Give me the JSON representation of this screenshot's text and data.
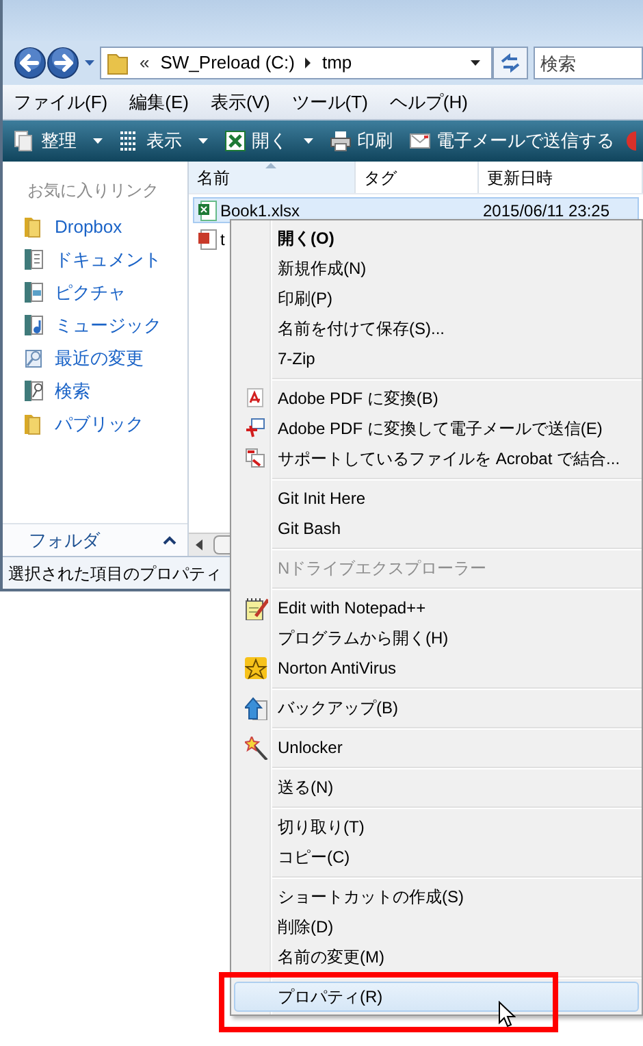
{
  "address": {
    "overflow": "«",
    "segments": [
      "SW_Preload (C:)",
      "tmp"
    ]
  },
  "search": {
    "placeholder": "検索"
  },
  "menu_bar": [
    "ファイル(F)",
    "編集(E)",
    "表示(V)",
    "ツール(T)",
    "ヘルプ(H)"
  ],
  "toolbar": [
    {
      "label": "整理",
      "kind": "organize",
      "dropdown": true
    },
    {
      "label": "表示",
      "kind": "views",
      "dropdown": true
    },
    {
      "label": "開く",
      "kind": "excel",
      "dropdown": true
    },
    {
      "label": "印刷",
      "kind": "print",
      "dropdown": false
    },
    {
      "label": "電子メールで送信する",
      "kind": "mail",
      "dropdown": false
    }
  ],
  "sidebar": {
    "header": "お気に入りリンク",
    "items": [
      {
        "label": "Dropbox",
        "kind": "folder"
      },
      {
        "label": "ドキュメント",
        "kind": "documents"
      },
      {
        "label": "ピクチャ",
        "kind": "pictures"
      },
      {
        "label": "ミュージック",
        "kind": "music"
      },
      {
        "label": "最近の変更",
        "kind": "recent"
      },
      {
        "label": "検索",
        "kind": "search"
      },
      {
        "label": "パブリック",
        "kind": "folder"
      }
    ],
    "folders": "フォルダ"
  },
  "table": {
    "columns": [
      "名前",
      "タグ",
      "更新日時"
    ],
    "rows": [
      {
        "name": "Book1.xlsx",
        "date": "2015/06/11 23:25",
        "kind": "excel",
        "selected": true
      },
      {
        "name": "t",
        "kind": "pdf",
        "selected": false
      }
    ]
  },
  "status_bar": "選択された項目のプロパティ",
  "context_menu": [
    {
      "kind": "default",
      "label": "開く(O)",
      "selected": false,
      "disabled": false
    },
    {
      "kind": "plain",
      "label": "新規作成(N)",
      "selected": false,
      "disabled": false
    },
    {
      "kind": "plain",
      "label": "印刷(P)",
      "selected": false,
      "disabled": false
    },
    {
      "kind": "plain",
      "label": "名前を付けて保存(S)...",
      "selected": false,
      "disabled": false
    },
    {
      "kind": "plain",
      "label": "7-Zip",
      "selected": false,
      "disabled": false
    },
    {
      "kind": "separator"
    },
    {
      "kind": "pdf",
      "label": "Adobe PDF に変換(B)",
      "selected": false,
      "disabled": false
    },
    {
      "kind": "pdfmail",
      "label": "Adobe PDF に変換して電子メールで送信(E)",
      "selected": false,
      "disabled": false
    },
    {
      "kind": "combine",
      "label": "サポートしているファイルを Acrobat で結合...",
      "selected": false,
      "disabled": false
    },
    {
      "kind": "separator"
    },
    {
      "kind": "plain",
      "label": "Git Init Here",
      "selected": false,
      "disabled": false
    },
    {
      "kind": "plain",
      "label": "Git Bash",
      "selected": false,
      "disabled": false
    },
    {
      "kind": "separator"
    },
    {
      "kind": "plain",
      "label": "Nドライブエクスプローラー",
      "selected": false,
      "disabled": true
    },
    {
      "kind": "separator"
    },
    {
      "kind": "notepad",
      "label": "Edit with Notepad++",
      "selected": false,
      "disabled": false
    },
    {
      "kind": "plain",
      "label": "プログラムから開く(H)",
      "selected": false,
      "disabled": false
    },
    {
      "kind": "norton",
      "label": "Norton AntiVirus",
      "selected": false,
      "disabled": false
    },
    {
      "kind": "separator"
    },
    {
      "kind": "backup",
      "label": "バックアップ(B)",
      "selected": false,
      "disabled": false
    },
    {
      "kind": "separator"
    },
    {
      "kind": "unlocker",
      "label": "Unlocker",
      "selected": false,
      "disabled": false
    },
    {
      "kind": "separator"
    },
    {
      "kind": "plain",
      "label": "送る(N)",
      "selected": false,
      "disabled": false
    },
    {
      "kind": "separator"
    },
    {
      "kind": "plain",
      "label": "切り取り(T)",
      "selected": false,
      "disabled": false
    },
    {
      "kind": "plain",
      "label": "コピー(C)",
      "selected": false,
      "disabled": false
    },
    {
      "kind": "separator"
    },
    {
      "kind": "plain",
      "label": "ショートカットの作成(S)",
      "selected": false,
      "disabled": false
    },
    {
      "kind": "plain",
      "label": "削除(D)",
      "selected": false,
      "disabled": false
    },
    {
      "kind": "plain",
      "label": "名前の変更(M)",
      "selected": false,
      "disabled": false
    },
    {
      "kind": "separator"
    },
    {
      "kind": "plain",
      "label": "プロパティ(R)",
      "selected": true,
      "disabled": false
    }
  ]
}
